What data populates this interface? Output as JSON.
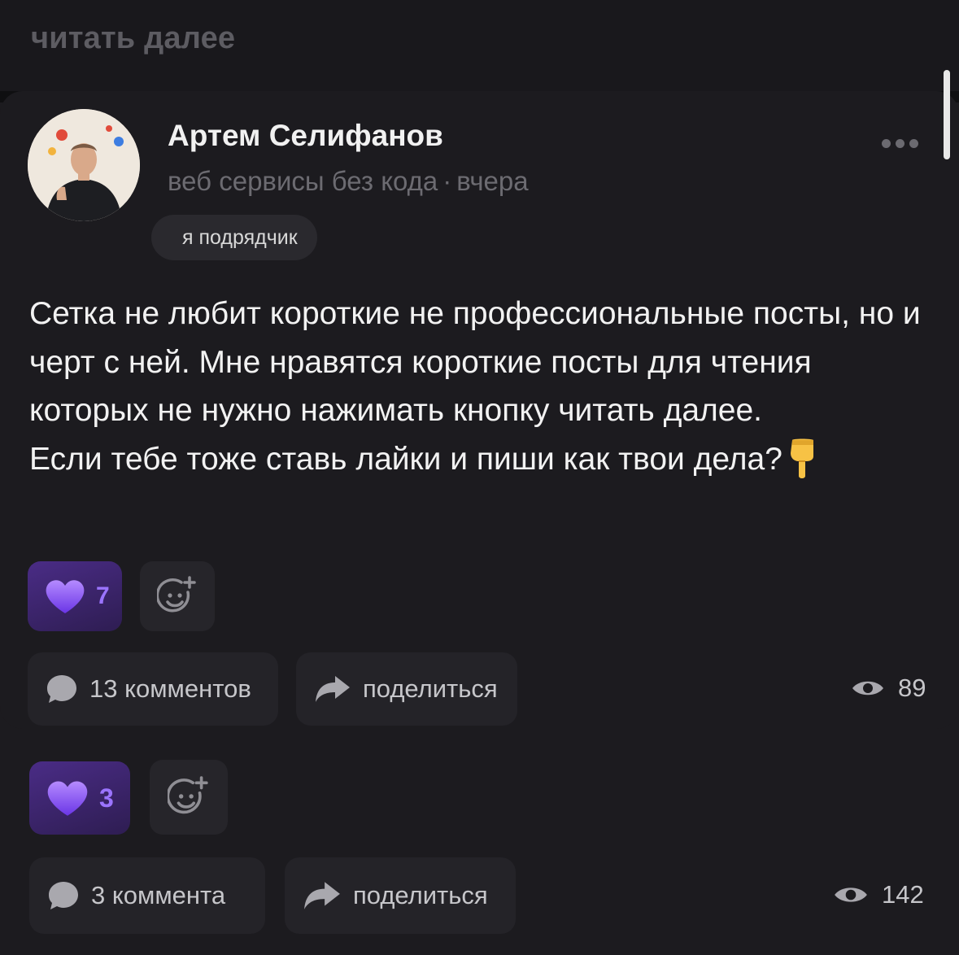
{
  "previous_post": {
    "read_more_label": "читать далее"
  },
  "post": {
    "author": {
      "name": "Артем Селифанов",
      "headline": "веб сервисы без кода",
      "separator": "·",
      "time": "вчера",
      "role_badge": "я подрядчик"
    },
    "text_paragraphs": [
      "Сетка не любит короткие не профессиональные посты, но и черт с ней. Мне нравятся короткие посты для чтения которых не нужно нажимать кнопку читать далее.",
      "Если тебе тоже ставь лайки и пиши как твои дела?"
    ],
    "emoji": "👇",
    "reaction": {
      "icon": "purple-heart-icon",
      "count": "7"
    },
    "comments_label": "13 комментов",
    "share_label": "поделиться",
    "views": "89"
  },
  "next_post": {
    "reaction": {
      "icon": "purple-heart-icon",
      "count": "3"
    },
    "comments_label": "3 коммента",
    "share_label": "поделиться",
    "views": "142"
  },
  "colors": {
    "background": "#1c1b1f",
    "accent_purple": "#9b74ff",
    "reaction_bg": "#4a2c86",
    "button_bg": "#242328",
    "muted_text": "#6c6b71"
  }
}
